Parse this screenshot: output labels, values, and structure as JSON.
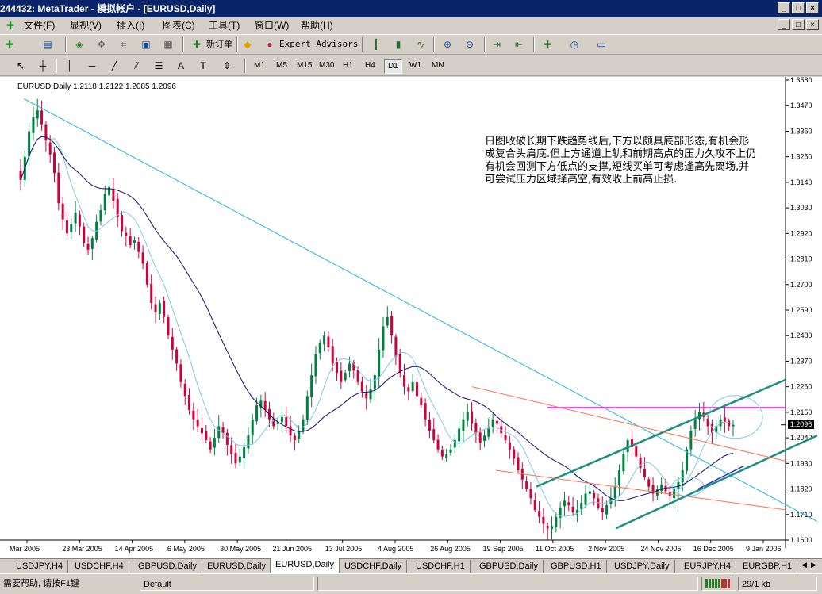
{
  "window": {
    "title": "244432: MetaTrader - 模拟帐户 - [EURUSD,Daily]",
    "min": "_",
    "max": "□",
    "close": "×"
  },
  "menu": [
    "文件(F)",
    "显视(V)",
    "插入(I)",
    "图表(C)",
    "工具(T)",
    "窗口(W)",
    "帮助(H)"
  ],
  "toolbar": {
    "new_order": "新订单",
    "expert_advisors": "Expert Advisors"
  },
  "timeframes": [
    "M1",
    "M5",
    "M15",
    "M30",
    "H1",
    "H4",
    "D1",
    "W1",
    "MN"
  ],
  "active_timeframe": "D1",
  "symbol_info": "EURUSD,Daily  1.2118 1.2122 1.2085 1.2096",
  "annotation": "日图收破长期下跌趋势线后,下方以颇具底部形态,有机会形成复合头肩底.但上方通道上轨和前期高点的压力久攻不上仍有机会回测下方低点的支撑,短线买单可考虑逢高先离场,并可尝试压力区域择高空,有效收上前高止损.",
  "current_price": "1.2096",
  "chart_data": {
    "type": "candlestick",
    "symbol": "EURUSD",
    "timeframe": "Daily",
    "last_bar": {
      "open": 1.2118,
      "high": 1.2122,
      "low": 1.2085,
      "close": 1.2096
    },
    "price_axis": [
      "1.3580",
      "1.3470",
      "1.3360",
      "1.3250",
      "1.3140",
      "1.3030",
      "1.2920",
      "1.2810",
      "1.2700",
      "1.2590",
      "1.2480",
      "1.2370",
      "1.2260",
      "1.2150",
      "1.2040",
      "1.1930",
      "1.1820",
      "1.1710",
      "1.1600"
    ],
    "ylim": [
      1.16,
      1.358
    ],
    "date_axis": [
      "Mar 2005",
      "23 Mar 2005",
      "14 Apr 2005",
      "6 May 2005",
      "30 May 2005",
      "21 Jun 2005",
      "13 Jul 2005",
      "4 Aug 2005",
      "26 Aug 2005",
      "19 Sep 2005",
      "11 Oct 2005",
      "2 Nov 2005",
      "24 Nov 2005",
      "16 Dec 2005",
      "9 Jan 2006"
    ],
    "closes": [
      1.315,
      1.325,
      1.336,
      1.342,
      1.345,
      1.339,
      1.332,
      1.326,
      1.318,
      1.305,
      1.298,
      1.292,
      1.296,
      1.301,
      1.295,
      1.288,
      1.285,
      1.29,
      1.297,
      1.302,
      1.309,
      1.312,
      1.306,
      1.299,
      1.293,
      1.291,
      1.287,
      1.289,
      1.284,
      1.279,
      1.27,
      1.262,
      1.258,
      1.262,
      1.256,
      1.248,
      1.242,
      1.236,
      1.228,
      1.222,
      1.216,
      1.212,
      1.209,
      1.206,
      1.203,
      1.199,
      1.204,
      1.209,
      1.206,
      1.201,
      1.197,
      1.193,
      1.196,
      1.2,
      1.205,
      1.212,
      1.218,
      1.22,
      1.216,
      1.212,
      1.209,
      1.211,
      1.213,
      1.209,
      1.205,
      1.203,
      1.207,
      1.212,
      1.222,
      1.231,
      1.24,
      1.245,
      1.248,
      1.243,
      1.236,
      1.232,
      1.228,
      1.232,
      1.236,
      1.233,
      1.228,
      1.224,
      1.221,
      1.225,
      1.231,
      1.242,
      1.252,
      1.256,
      1.248,
      1.239,
      1.232,
      1.226,
      1.224,
      1.228,
      1.222,
      1.218,
      1.212,
      1.207,
      1.203,
      1.199,
      1.196,
      1.197,
      1.199,
      1.203,
      1.208,
      1.212,
      1.215,
      1.21,
      1.206,
      1.202,
      1.205,
      1.208,
      1.212,
      1.21,
      1.206,
      1.203,
      1.199,
      1.195,
      1.19,
      1.186,
      1.182,
      1.178,
      1.173,
      1.17,
      1.167,
      1.165,
      1.166,
      1.17,
      1.174,
      1.177,
      1.175,
      1.172,
      1.173,
      1.176,
      1.18,
      1.181,
      1.178,
      1.174,
      1.172,
      1.175,
      1.178,
      1.183,
      1.19,
      1.197,
      1.203,
      1.2,
      1.196,
      1.191,
      1.187,
      1.183,
      1.18,
      1.182,
      1.184,
      1.181,
      1.179,
      1.182,
      1.185,
      1.19,
      1.199,
      1.207,
      1.212,
      1.215,
      1.213,
      1.209,
      1.206,
      1.209,
      1.212,
      1.211,
      1.209,
      1.2096
    ],
    "lines": [
      {
        "name": "long-term downtrend line",
        "color": "#1fb5e0"
      },
      {
        "name": "resistance (previous high)",
        "color": "#ff00ff",
        "value": 1.217
      },
      {
        "name": "channel upper rail",
        "color": "#1a9080"
      },
      {
        "name": "channel lower rail",
        "color": "#1a9080"
      },
      {
        "name": "orange trend line upper",
        "color": "#ff7050"
      },
      {
        "name": "orange trend line lower",
        "color": "#ff7050"
      },
      {
        "name": "MA fast",
        "color": "#7ec8e8"
      },
      {
        "name": "MA slow",
        "color": "#101070"
      }
    ]
  },
  "tabs": [
    "USDJPY,H4",
    "USDCHF,H4",
    "GBPUSD,Daily",
    "EURUSD,Daily",
    "EURUSD,Daily",
    "USDCHF,Daily",
    "USDCHF,H1",
    "GBPUSD,Daily",
    "GBPUSD,H1",
    "USDJPY,Daily",
    "EURJPY,H4",
    "EURGBP,H1"
  ],
  "active_tab_index": 4,
  "status": {
    "help": "需要帮助, 请按F1键",
    "profile": "Default",
    "traffic": "29/1 kb"
  }
}
